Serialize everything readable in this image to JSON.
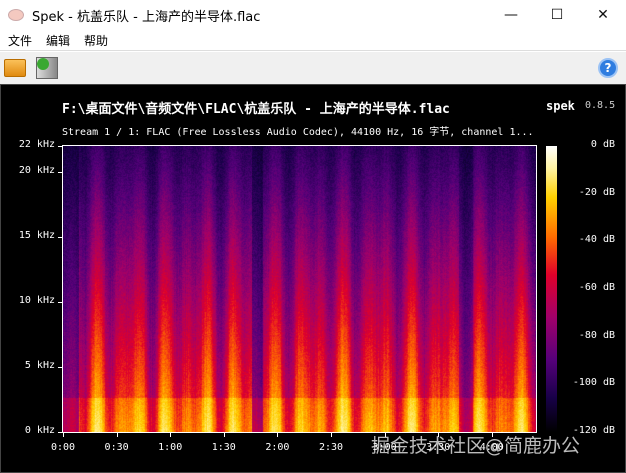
{
  "window": {
    "title": "Spek - 杭盖乐队 - 上海产的半导体.flac",
    "minimize": "—",
    "maximize": "☐",
    "close": "✕"
  },
  "menu": [
    "文件",
    "编辑",
    "帮助"
  ],
  "toolbar": {
    "open_icon": "folder-icon",
    "save_icon": "save-image-icon",
    "help_icon": "help-icon",
    "help": "?"
  },
  "file": {
    "path": "F:\\桌面文件\\音频文件\\FLAC\\杭盖乐队 - 上海产的半导体.flac",
    "info": "Stream 1 / 1: FLAC (Free Lossless Audio Codec), 44100 Hz, 16 字节, channel 1..."
  },
  "brand": {
    "name": "spek",
    "version": "0.8.5"
  },
  "freq_axis": [
    "22 kHz",
    "20 kHz",
    "15 kHz",
    "10 kHz",
    "5 kHz",
    "0 kHz"
  ],
  "time_axis": [
    "0:00",
    "0:30",
    "1:00",
    "1:30",
    "2:00",
    "2:30",
    "3:00",
    "3:30",
    "4:00"
  ],
  "db_axis": [
    "0 dB",
    "-20 dB",
    "-40 dB",
    "-60 dB",
    "-80 dB",
    "-100 dB",
    "-120 dB"
  ],
  "watermark": "掘金技术社区@简鹿办公"
}
